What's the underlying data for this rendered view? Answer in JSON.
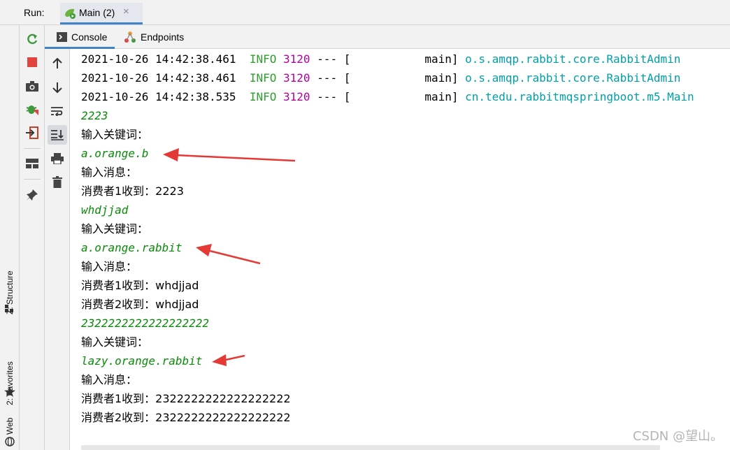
{
  "run_bar": {
    "label": "Run:",
    "tab_label": "Main (2)",
    "close_glyph": "×",
    "tab_icon": "spring-run-icon"
  },
  "side_stripe": {
    "structure_label": "Z: Structure",
    "favorites_label": "2: Favorites",
    "web_label": "Web"
  },
  "sub_tabs": [
    {
      "label": "Console",
      "icon": "console-icon",
      "active": true
    },
    {
      "label": "Endpoints",
      "icon": "endpoints-icon",
      "active": false
    }
  ],
  "toolbar": {
    "rerun": "rerun-icon",
    "stop": "stop-icon",
    "snapshot": "camera-icon",
    "debug": "bug-icon",
    "exit": "exit-icon",
    "layout": "layout-icon",
    "pin": "pin-icon",
    "up": "arrow-up-icon",
    "down": "arrow-down-icon",
    "wrap": "soft-wrap-icon",
    "scroll_end": "scroll-to-end-icon",
    "print": "print-icon",
    "trash": "trash-icon"
  },
  "log_lines": [
    {
      "ts": "2021-10-26 14:42:38.461",
      "level": "INFO",
      "pid": "3120",
      "sep": "---",
      "thread": "[           main]",
      "logger": "o.s.amqp.rabbit.core.RabbitAdmin"
    },
    {
      "ts": "2021-10-26 14:42:38.461",
      "level": "INFO",
      "pid": "3120",
      "sep": "---",
      "thread": "[           main]",
      "logger": "o.s.amqp.rabbit.core.RabbitAdmin"
    },
    {
      "ts": "2021-10-26 14:42:38.535",
      "level": "INFO",
      "pid": "3120",
      "sep": "---",
      "thread": "[           main]",
      "logger": "cn.tedu.rabbitmqspringboot.m5.Main"
    }
  ],
  "console_lines": [
    {
      "text": "2223",
      "kind": "input"
    },
    {
      "text": "输入关键词：",
      "kind": "output"
    },
    {
      "text": "a.orange.b",
      "kind": "input"
    },
    {
      "text": "输入消息：",
      "kind": "output"
    },
    {
      "text": "消费者1收到：2223",
      "kind": "output"
    },
    {
      "text": "whdjjad",
      "kind": "input"
    },
    {
      "text": "输入关键词：",
      "kind": "output"
    },
    {
      "text": "a.orange.rabbit",
      "kind": "input"
    },
    {
      "text": "输入消息：",
      "kind": "output"
    },
    {
      "text": "消费者1收到：whdjjad",
      "kind": "output"
    },
    {
      "text": "消费者2收到：whdjjad",
      "kind": "output"
    },
    {
      "text": "2322222222222222222",
      "kind": "input"
    },
    {
      "text": "输入关键词：",
      "kind": "output"
    },
    {
      "text": "lazy.orange.rabbit",
      "kind": "input"
    },
    {
      "text": "输入消息：",
      "kind": "output"
    },
    {
      "text": "消费者1收到：2322222222222222222",
      "kind": "output"
    },
    {
      "text": "消费者2收到：2322222222222222222",
      "kind": "output"
    }
  ],
  "watermark": "CSDN @望山。",
  "colors": {
    "accent": "#4083c9",
    "info": "#2e9e2e",
    "pid": "#b4009e",
    "logger": "#00a0a8",
    "user_input": "#098b09",
    "annotation_arrow": "#e53935",
    "stop": "#e0443e",
    "rerun": "#3c9a3c"
  }
}
